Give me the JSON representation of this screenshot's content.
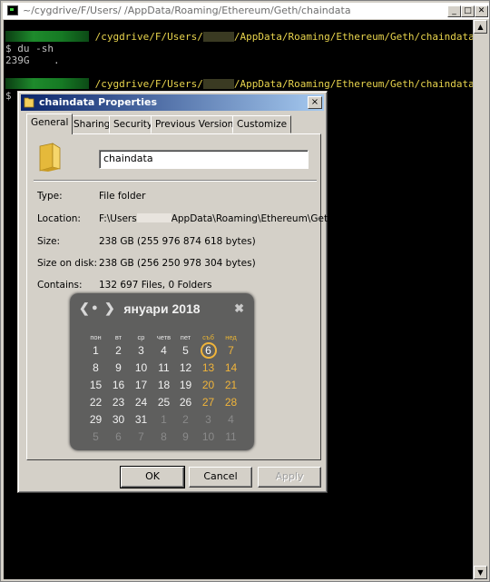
{
  "terminal": {
    "title": "~/cygdrive/F/Users/        /AppData/Roaming/Ethereum/Geth/chaindata",
    "path": "/cygdrive/F/Users/",
    "path_rest": "/AppData/Roaming/Ethereum/Geth/chaindata",
    "command": "$ du -sh",
    "output": "239G    .",
    "prompt2": "$"
  },
  "dialog": {
    "title": "chaindata Properties",
    "close": "×",
    "tabs": [
      "General",
      "Sharing",
      "Security",
      "Previous Versions",
      "Customize"
    ],
    "name_value": "chaindata",
    "type_label": "Type:",
    "type_value": "File folder",
    "location_label": "Location:",
    "location_prefix": "F:\\Users",
    "location_suffix": "AppData\\Roaming\\Ethereum\\Geth",
    "size_label": "Size:",
    "size_value": "238 GB (255 976 874 618 bytes)",
    "size_on_disk_label": "Size on disk:",
    "size_on_disk_value": "238 GB (256 250 978 304 bytes)",
    "contains_label": "Contains:",
    "contains_value": "132 697 Files, 0 Folders",
    "ok": "OK",
    "cancel": "Cancel",
    "apply": "Apply"
  },
  "calendar": {
    "title": "януари 2018",
    "close": "✖",
    "nav_prev": "❮",
    "nav_today": "●",
    "nav_next": "❯",
    "weekdays": [
      "пон",
      "вт",
      "ср",
      "четв",
      "пет",
      "съб",
      "нед"
    ],
    "weeks": [
      [
        "1",
        "2",
        "3",
        "4",
        "5",
        "6",
        "7"
      ],
      [
        "8",
        "9",
        "10",
        "11",
        "12",
        "13",
        "14"
      ],
      [
        "15",
        "16",
        "17",
        "18",
        "19",
        "20",
        "21"
      ],
      [
        "22",
        "23",
        "24",
        "25",
        "26",
        "27",
        "28"
      ],
      [
        "29",
        "30",
        "31",
        "1",
        "2",
        "3",
        "4"
      ],
      [
        "5",
        "6",
        "7",
        "8",
        "9",
        "10",
        "11"
      ]
    ],
    "today": "6"
  }
}
